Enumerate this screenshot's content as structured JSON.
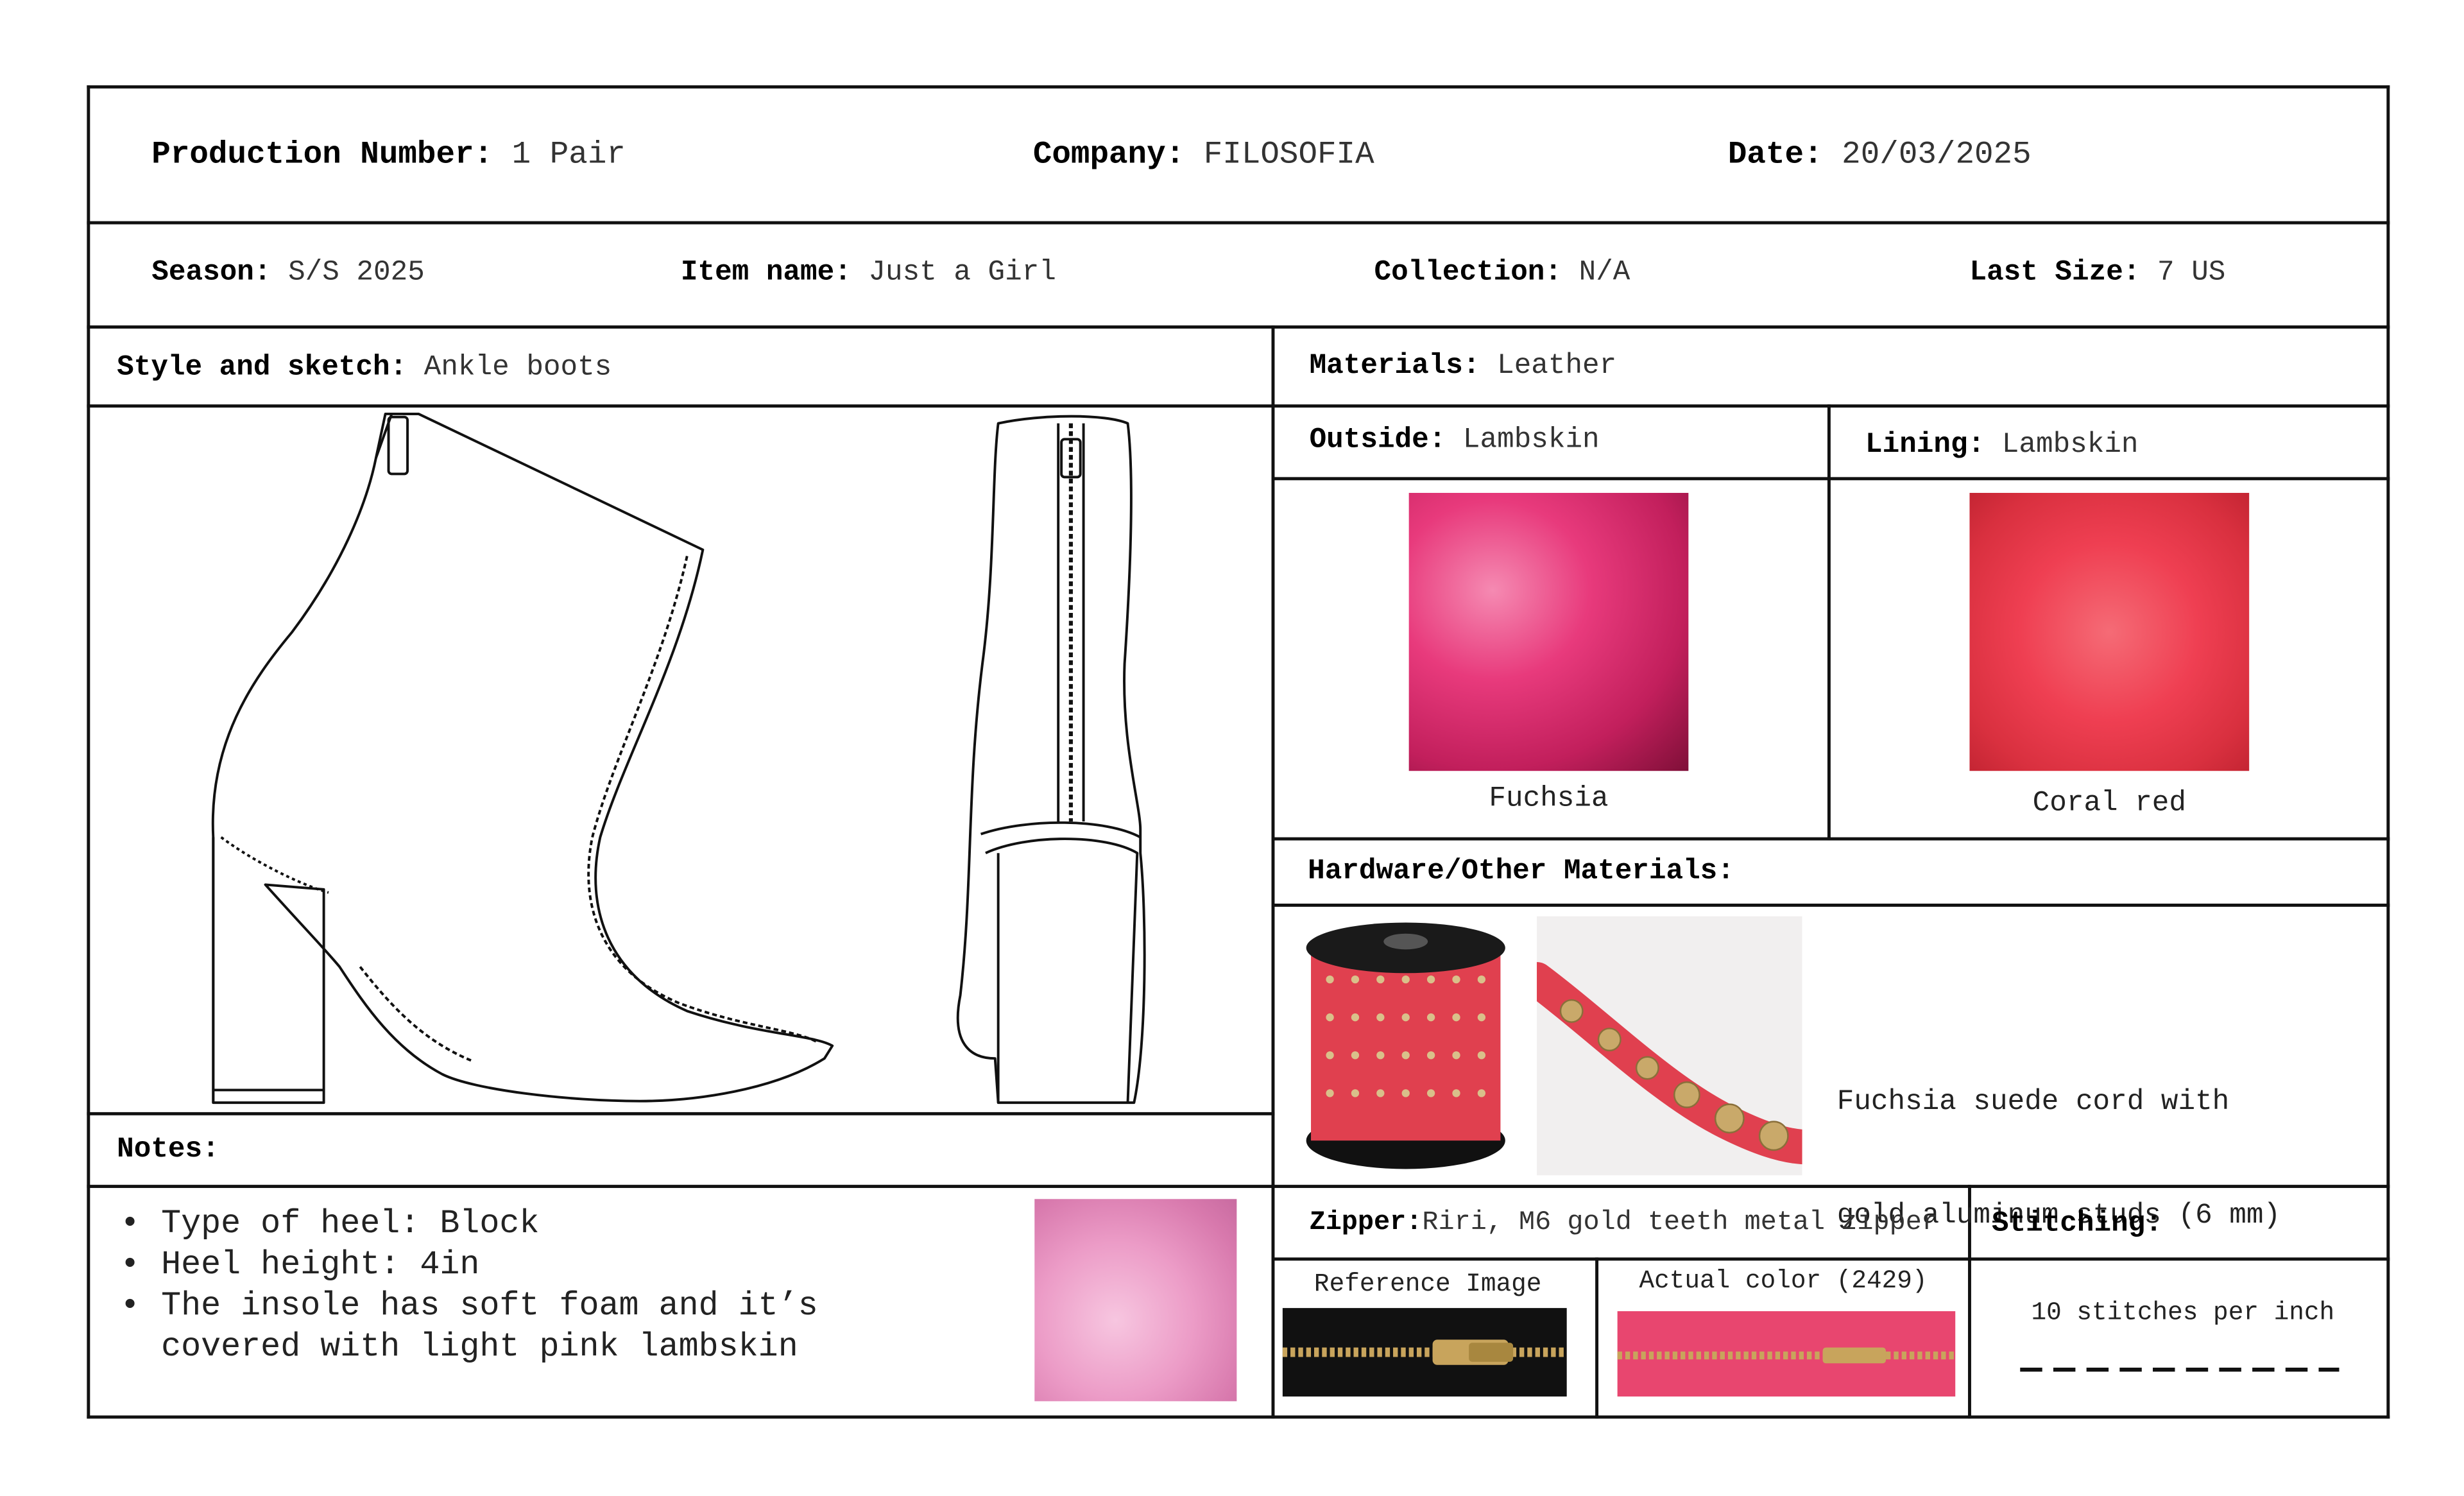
{
  "header": {
    "production_number_label": "Production Number:",
    "production_number_value": "1 Pair",
    "company_label": "Company:",
    "company_value": "FILOSOFIA",
    "date_label": "Date:",
    "date_value": "20/03/2025"
  },
  "row2": {
    "season_label": "Season:",
    "season_value": "S/S 2025",
    "item_label": "Item name:",
    "item_value": "Just a Girl",
    "collection_label": "Collection:",
    "collection_value": "N/A",
    "last_label": "Last Size:",
    "last_value": "7 US"
  },
  "style": {
    "label": "Style and sketch:",
    "value": "Ankle boots"
  },
  "materials": {
    "label": "Materials:",
    "value": "Leather",
    "outside_label": "Outside:",
    "outside_value": "Lambskin",
    "lining_label": "Lining:",
    "lining_value": "Lambskin",
    "outside_color": "Fuchsia",
    "lining_color": "Coral red",
    "outside_hex": "#e83a7c",
    "lining_hex": "#ef3f52"
  },
  "hardware": {
    "label": "Hardware/Other Materials:",
    "description_line1": "Fuchsia suede cord with",
    "description_line2": "gold aluminum studs (6 mm)",
    "cord_hex": "#e0404f",
    "stud_hex": "#c9a96a"
  },
  "notes": {
    "label": "Notes:",
    "items": [
      "Type of heel: Block",
      "Heel height: 4in",
      "The insole has soft foam and it’s\ncovered with light pink lambskin"
    ],
    "insole_hex": "#ec9cc7"
  },
  "zipper": {
    "label": "Zipper:",
    "value": "Riri, M6 gold teeth metal zipper",
    "reference_label": "Reference Image",
    "actual_label": "Actual color (2429)",
    "reference_tape_hex": "#111111",
    "actual_tape_hex": "#e8466f",
    "teeth_hex": "#c8a45c"
  },
  "stitching": {
    "label": "Stitching:",
    "value": "10 stitches per inch"
  }
}
